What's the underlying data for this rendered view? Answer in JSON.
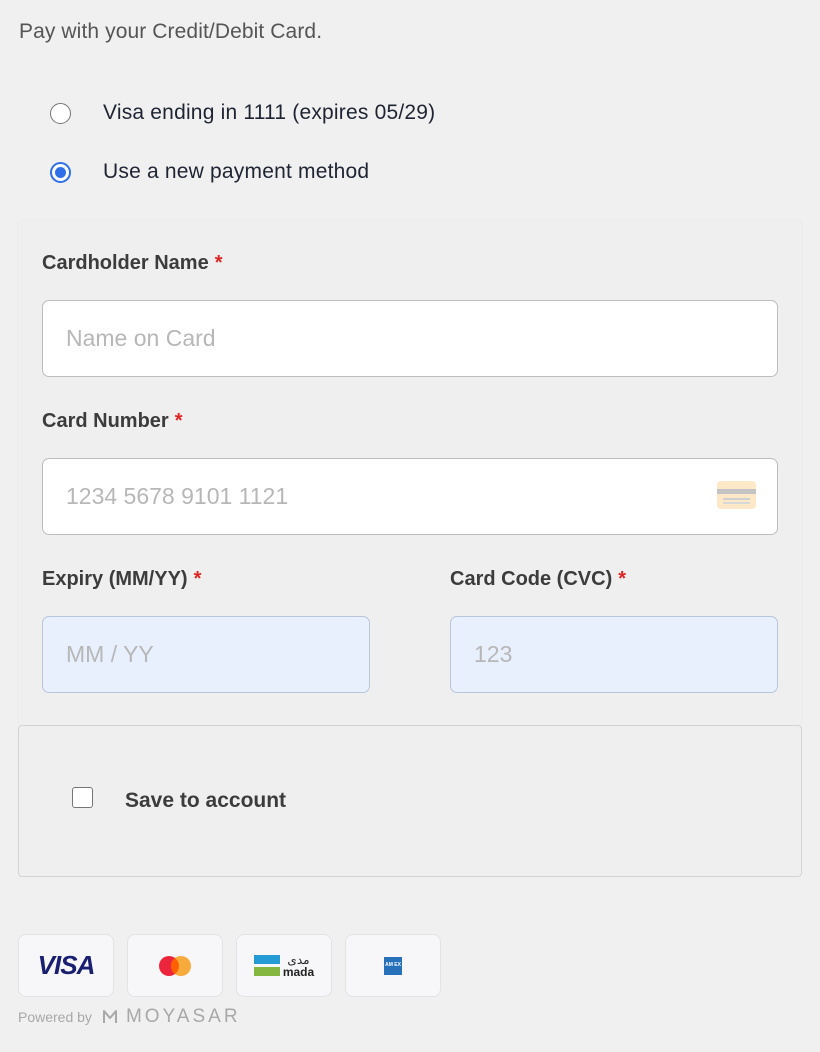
{
  "intro_text": "Pay with your Credit/Debit Card.",
  "payment_options": [
    {
      "label": "Visa ending in 1111 (expires 05/29)",
      "selected": false
    },
    {
      "label": "Use a new payment method",
      "selected": true
    }
  ],
  "form": {
    "cardholder_name": {
      "label": "Cardholder Name",
      "required_mark": "*",
      "placeholder": "Name on Card",
      "value": ""
    },
    "card_number": {
      "label": "Card Number",
      "required_mark": "*",
      "placeholder": "1234 5678 9101 1121",
      "value": ""
    },
    "expiry": {
      "label": "Expiry (MM/YY)",
      "required_mark": "*",
      "placeholder": "MM / YY",
      "value": ""
    },
    "cvc": {
      "label": "Card Code (CVC)",
      "required_mark": "*",
      "placeholder": "123",
      "value": ""
    }
  },
  "save_to_account": {
    "label": "Save to account",
    "checked": false
  },
  "brands": {
    "visa": "VISA",
    "mada_ar": "مدى",
    "mada_en": "mada",
    "amex": "AM EX"
  },
  "footer": {
    "powered_by": "Powered by",
    "provider": "MOYASAR"
  },
  "colors": {
    "accent": "#2f6fe8",
    "required": "#e02424",
    "autofill_bg": "#e8f0fe",
    "visa_blue": "#1a1f71",
    "mastercard_red": "#eb001b",
    "mastercard_orange": "#f79e1b",
    "mada_blue": "#259bd6",
    "mada_green": "#84b740",
    "amex_blue": "#2671b9"
  },
  "icons": {
    "card_number": "credit-card-icon",
    "provider": "moyasar-logo-icon"
  }
}
